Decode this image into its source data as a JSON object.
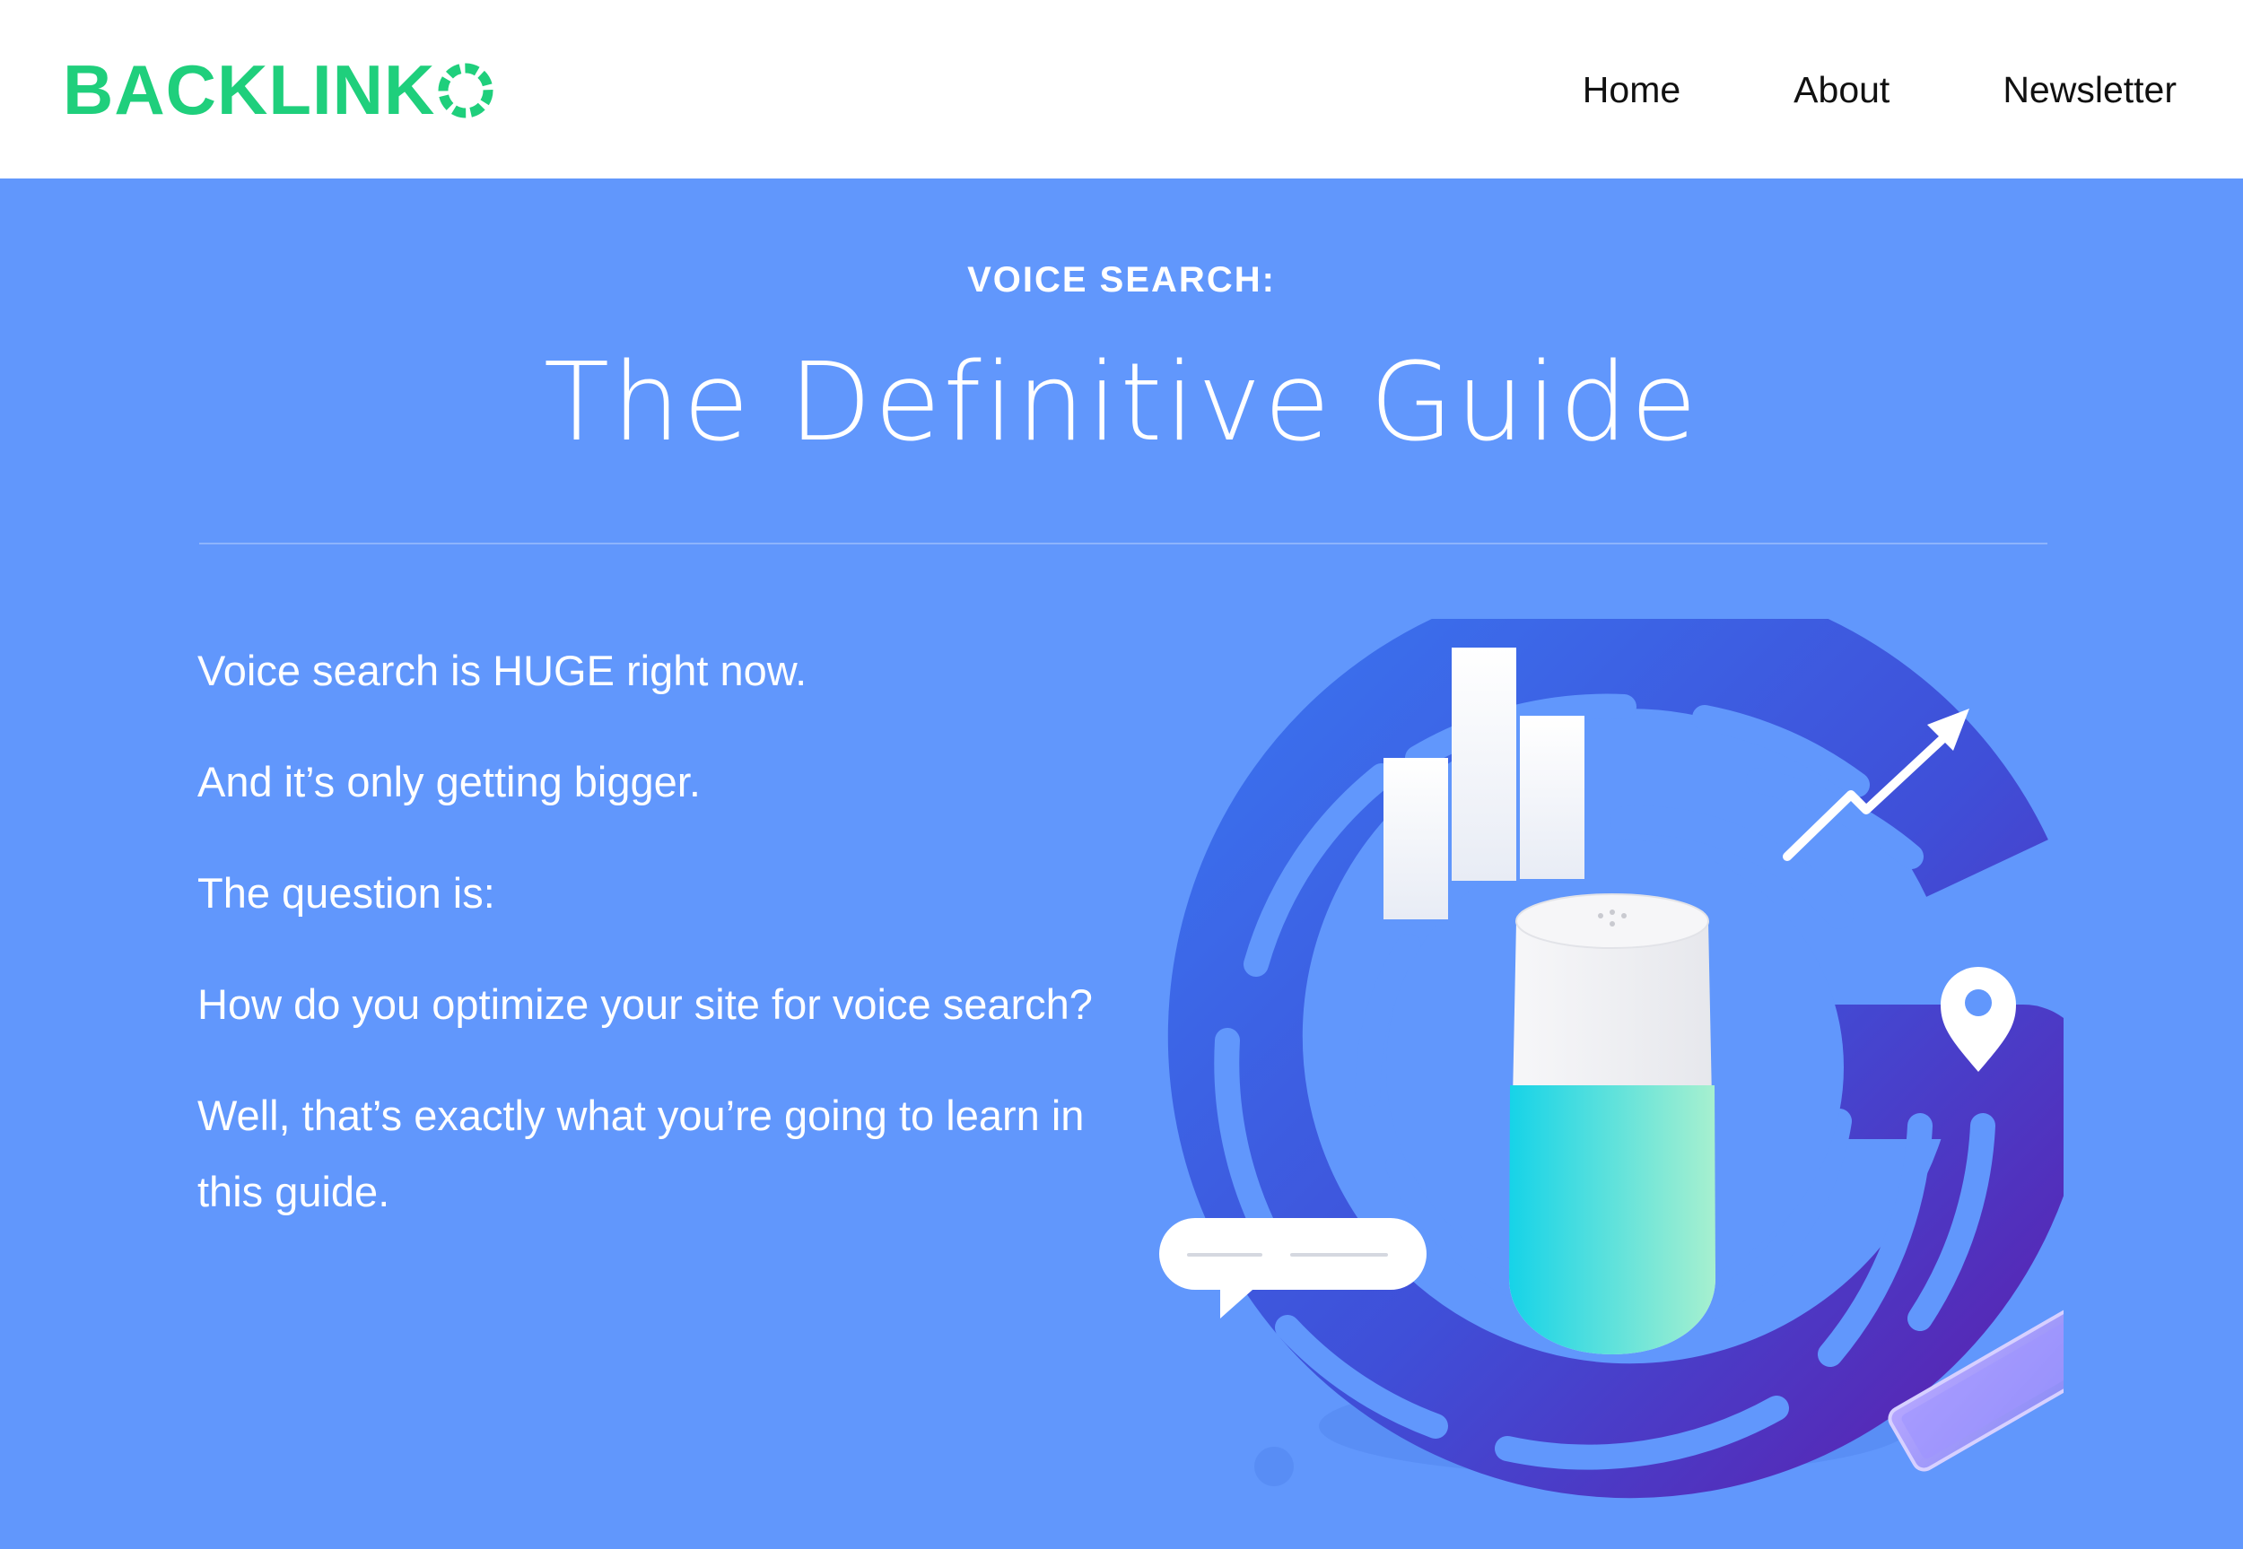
{
  "header": {
    "logo_text": "BACKLINK",
    "nav": [
      {
        "label": "Home"
      },
      {
        "label": "About"
      },
      {
        "label": "Newsletter"
      }
    ]
  },
  "hero": {
    "eyebrow": "VOICE SEARCH:",
    "title": "The Definitive Guide",
    "paragraphs": [
      "Voice search is HUGE right now.",
      "And it’s only getting bigger.",
      "The question is:",
      "How do you optimize your site for voice search?",
      "Well, that’s exactly what you’re going to learn in this guide."
    ]
  },
  "colors": {
    "brand_green": "#1fcf7c",
    "hero_blue": "#6197fc",
    "header_bg": "#ffffff"
  },
  "icons": {
    "logo_mark": "dashed-circle-o",
    "illustration": "voice-search-g-illustration"
  }
}
